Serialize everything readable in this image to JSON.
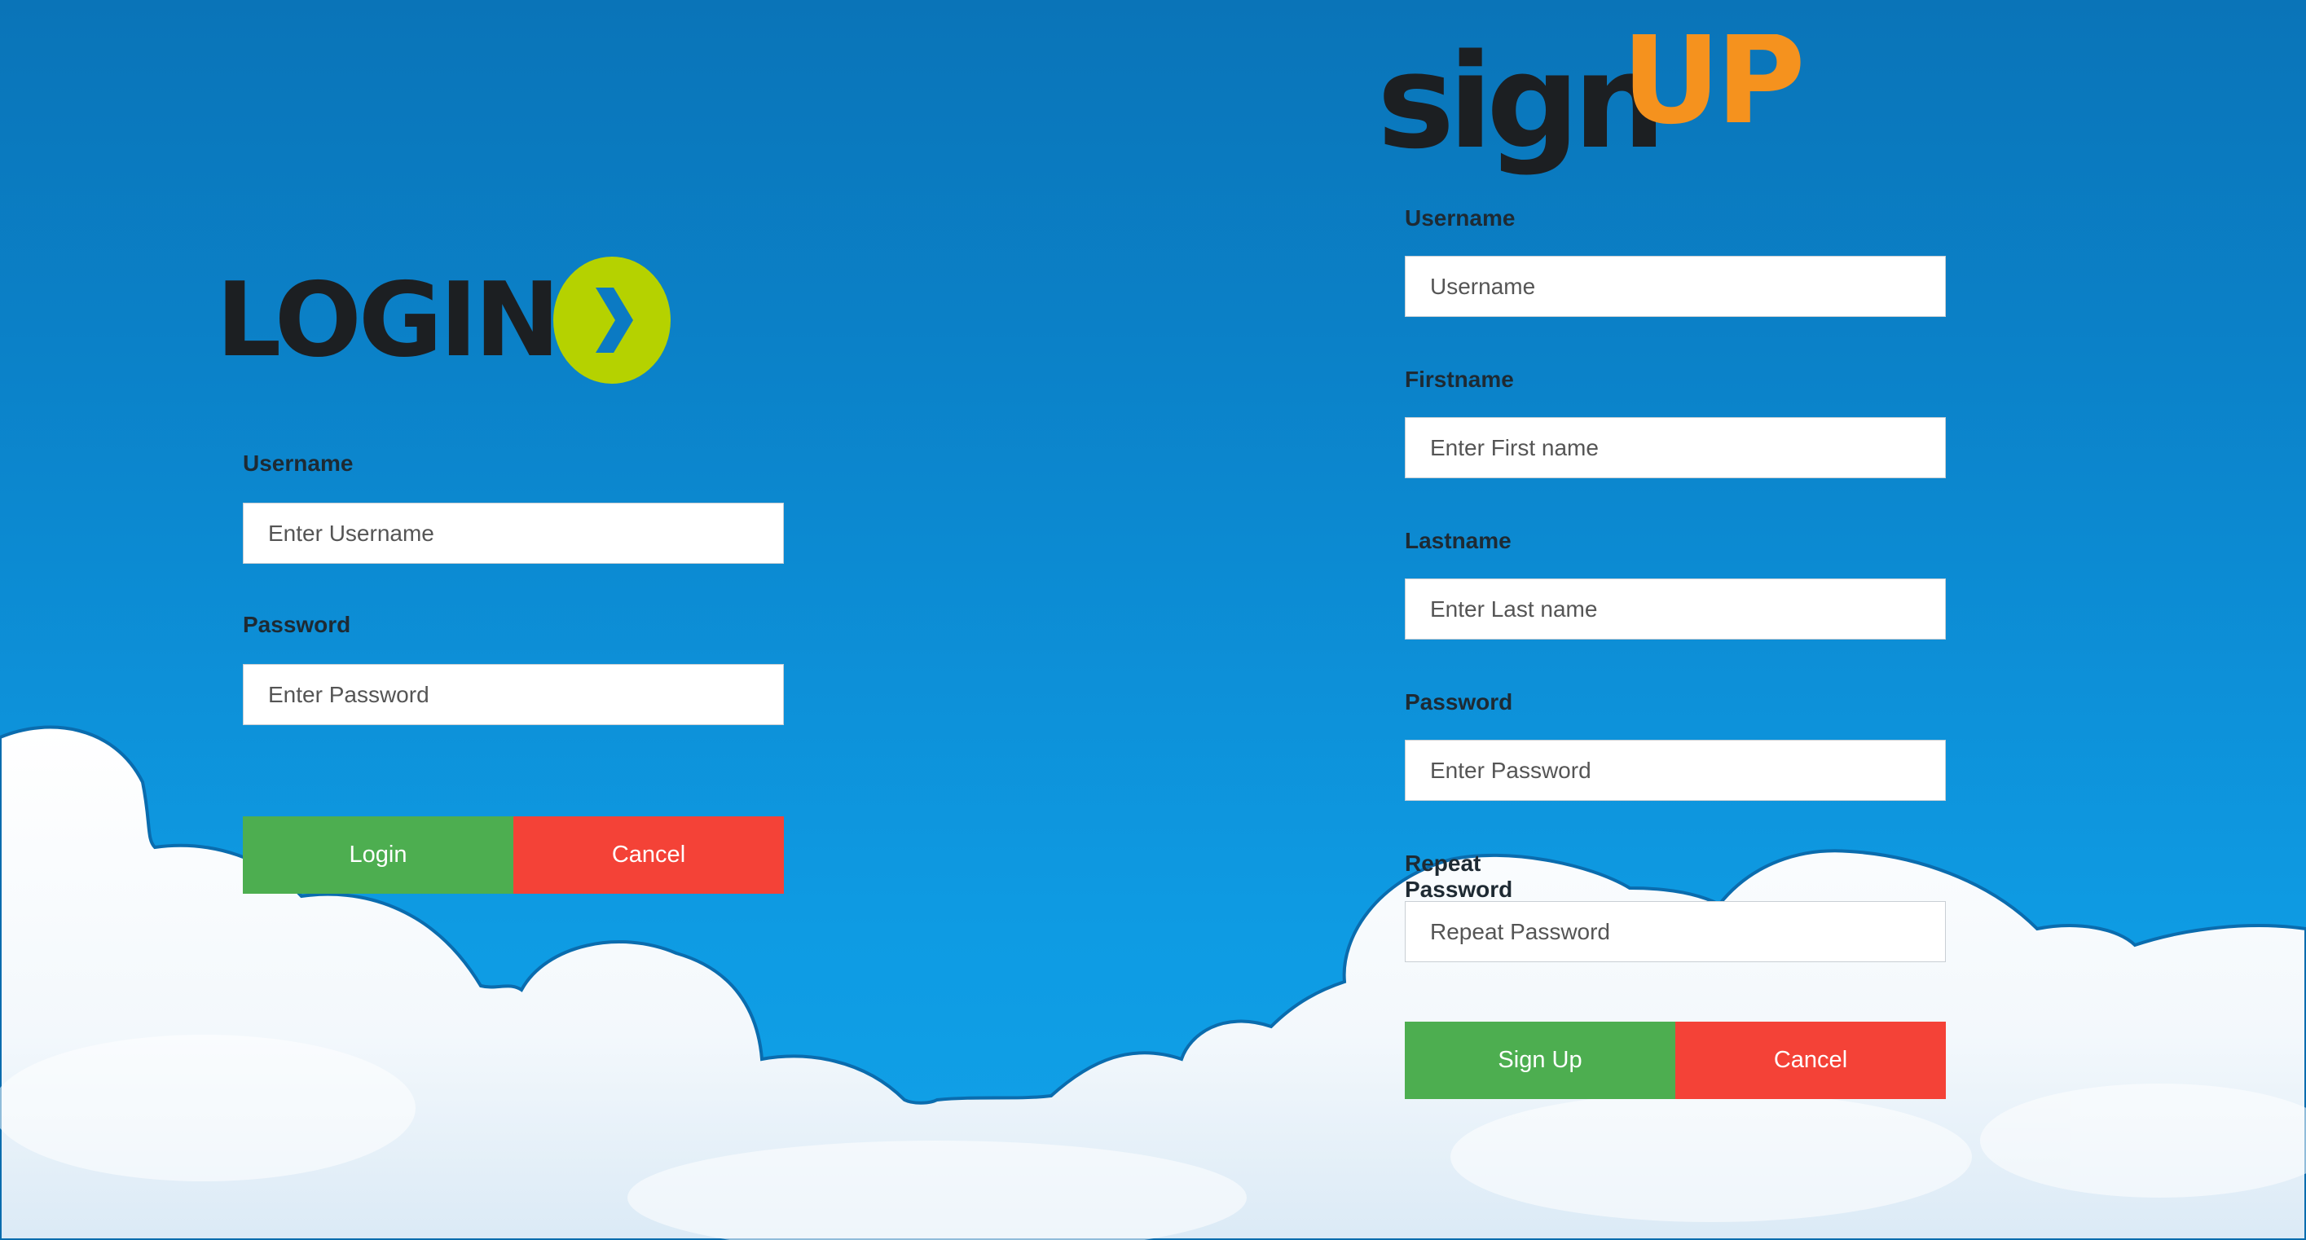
{
  "colors": {
    "sky": "#0b82c9",
    "button_primary": "#4dae50",
    "button_danger": "#f44237",
    "login_badge": "#b5d200",
    "signup_accent": "#f5921e",
    "logo_dark": "#1c1f22"
  },
  "login": {
    "logo_text": "LOGIN",
    "logo_icon": "chevron-right-icon",
    "username_label": "Username",
    "username_placeholder": "Enter Username",
    "password_label": "Password",
    "password_placeholder": "Enter Password",
    "submit_label": "Login",
    "cancel_label": "Cancel"
  },
  "signup": {
    "logo_text_dark": "sign",
    "logo_text_accent": "UP",
    "username_label": "Username",
    "username_placeholder": "Username",
    "firstname_label": "Firstname",
    "firstname_placeholder": "Enter First name",
    "lastname_label": "Lastname",
    "lastname_placeholder": "Enter Last name",
    "password_label": "Password",
    "password_placeholder": "Enter Password",
    "repeat_password_label": "Repeat Password",
    "repeat_password_placeholder": "Repeat Password",
    "submit_label": "Sign Up",
    "cancel_label": "Cancel"
  }
}
